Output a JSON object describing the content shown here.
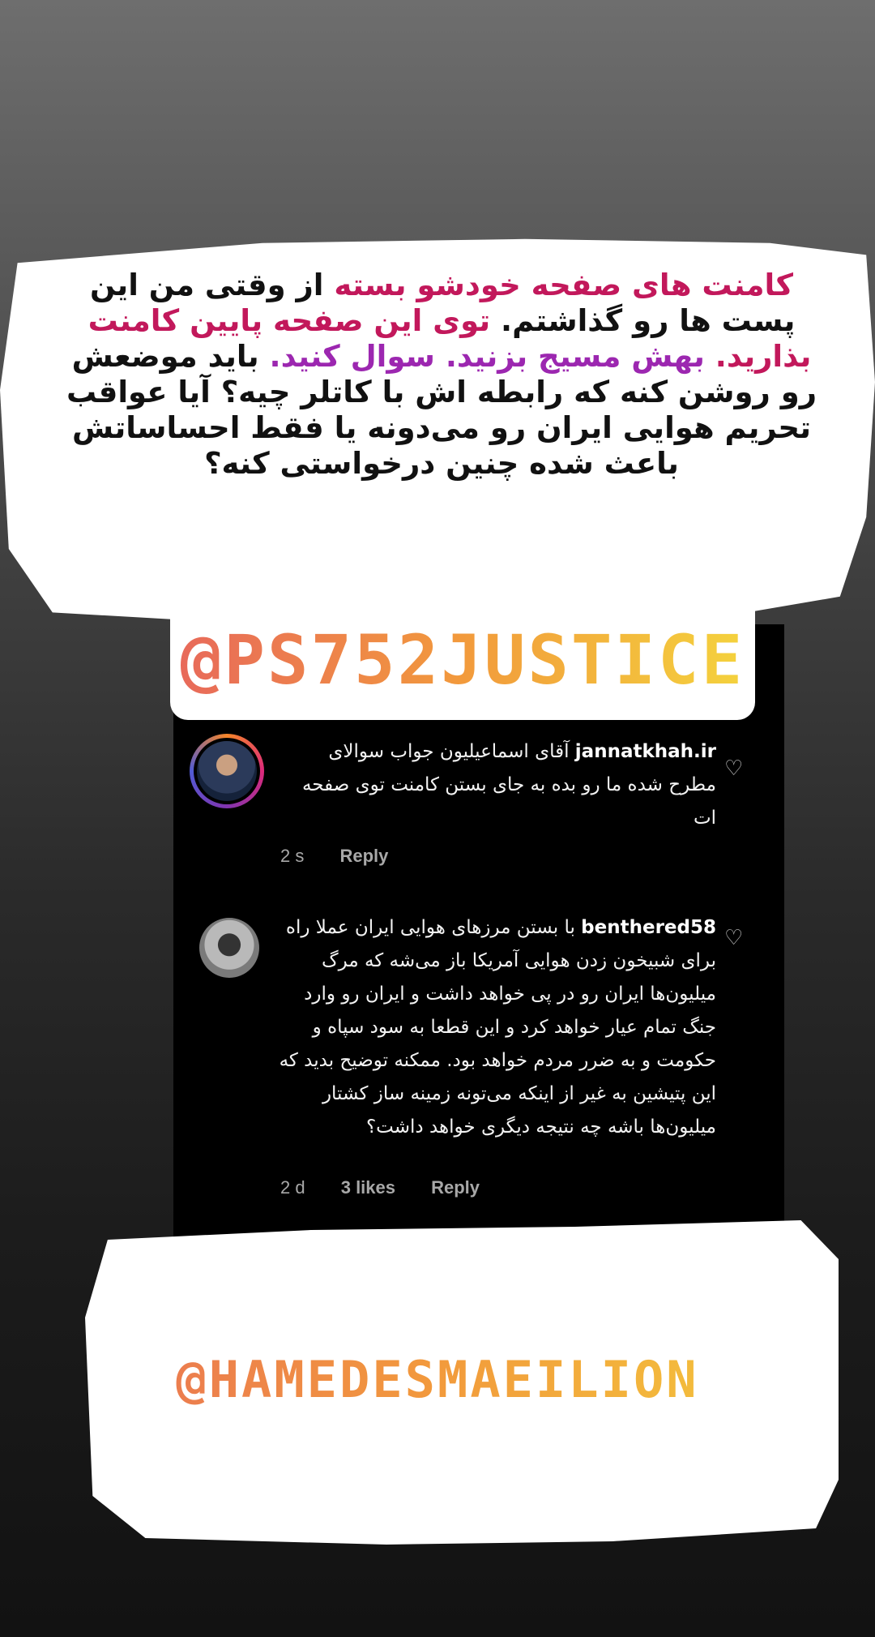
{
  "story_text": {
    "seg1": "کامنت های صفحه خودشو بسته",
    "seg2": " از وقتی من این پست ها رو گذاشتم. ",
    "seg3": "توی این صفحه پایین کامنت بذارید.",
    "seg4": " ",
    "seg5": "بهش مسیج بزنید. سوال کنید.",
    "seg6": " باید موضعش رو روشن کنه که رابطه اش با کاتلر چیه؟ آیا عواقب تحریم هوایی ایران رو می‌دونه یا فقط احساساتش باعث شده چنین درخواستی کنه؟"
  },
  "mention_top": "@PS752JUSTICE",
  "mention_bottom": "@HAMEDESMAEILION",
  "comments": [
    {
      "username": "jannatkhah.ir",
      "text": "آقای اسماعیلیون جواب سوالای مطرح شده ما رو بده به جای بستن کامنت توی صفحه ات",
      "time": "2 s",
      "likes": "",
      "reply": "Reply"
    },
    {
      "username": "benthered58",
      "text": "با بستن مرزهای هوایی ایران عملا راه برای شبیخون زدن هوایی آمریکا باز می‌شه که مرگ میلیون‌ها ایران رو در پی خواهد داشت و ایران رو وارد جنگ تمام عیار خواهد کرد و این قطعا به سود سپاه و حکومت و به ضرر مردم خواهد بود. ممکنه توضیح بدید که این پتیشین به غیر از اینکه می‌تونه زمینه ساز کشتار میلیون‌ها باشه چه نتیجه دیگری خواهد داشت؟",
      "time": "2 d",
      "likes": "3 likes",
      "reply": "Reply"
    }
  ],
  "icons": {
    "like": "heart-outline-icon"
  },
  "colors": {
    "pink": "#c2185b",
    "purple": "#9c27b0",
    "gradient_start": "#e86a5a",
    "gradient_end": "#f4d23d"
  }
}
